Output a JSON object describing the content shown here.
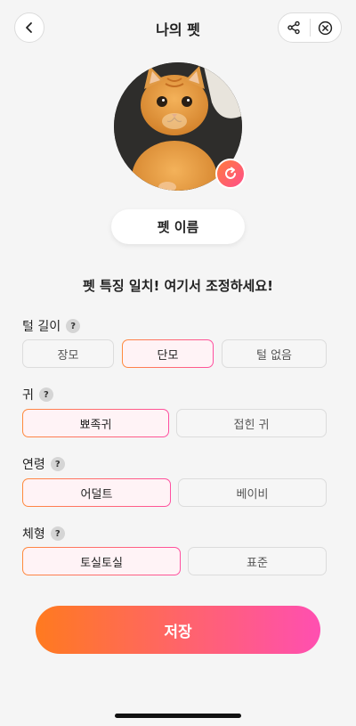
{
  "header": {
    "title": "나의 펫",
    "back_icon": "chevron-left-icon",
    "share_icon": "share-icon",
    "close_icon": "close-circle-icon"
  },
  "pet": {
    "name_button": "펫 이름",
    "photo_alt": "orange tabby cat photo",
    "refresh_icon": "refresh-icon"
  },
  "prompt": "펫 특징 일치! 여기서 조정하세요!",
  "sections": {
    "fur": {
      "label": "털 길이",
      "options": [
        "장모",
        "단모",
        "털 없음"
      ],
      "selected": "단모"
    },
    "ear": {
      "label": "귀",
      "options": [
        "뾰족귀",
        "접힌 귀"
      ],
      "selected": "뾰족귀"
    },
    "age": {
      "label": "연령",
      "options": [
        "어덜트",
        "베이비"
      ],
      "selected": "어덜트"
    },
    "body": {
      "label": "체형",
      "options": [
        "토실토실",
        "표준"
      ],
      "selected": "토실토실"
    }
  },
  "help_glyph": "?",
  "save_label": "저장",
  "colors": {
    "accent_start": "#ff7a1f",
    "accent_end": "#ff4fb1",
    "background": "#f5f5f5"
  }
}
